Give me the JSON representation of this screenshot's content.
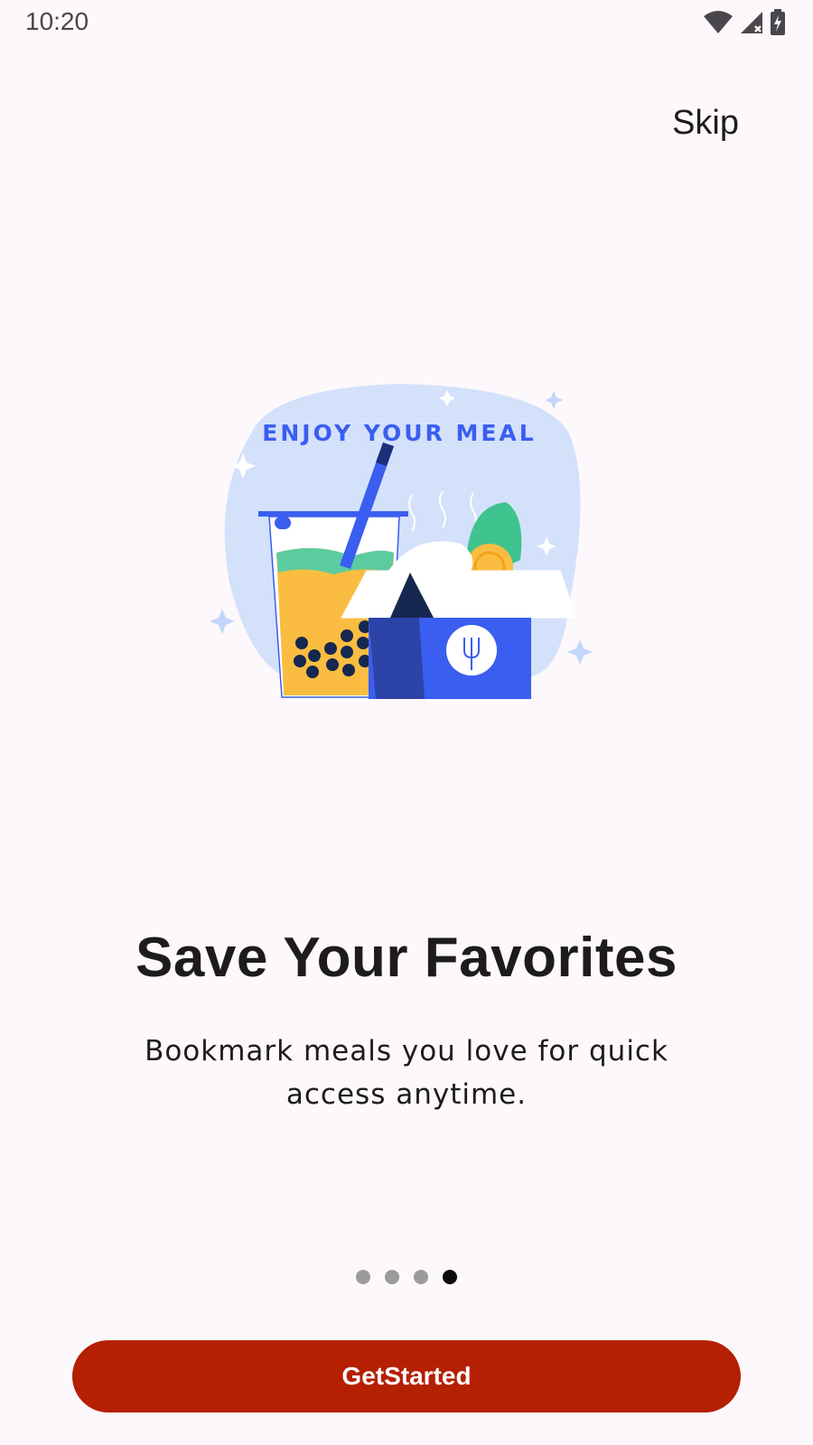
{
  "status_bar": {
    "time": "10:20",
    "icons": [
      "wifi-icon",
      "signal-icon",
      "battery-icon"
    ]
  },
  "header": {
    "skip_label": "Skip"
  },
  "illustration": {
    "banner_text": "ENJOY YOUR MEAL"
  },
  "content": {
    "title": "Save Your Favorites",
    "description": "Bookmark meals you love for quick access anytime."
  },
  "pager": {
    "total": 4,
    "active_index": 3
  },
  "cta": {
    "label": "GetStarted"
  },
  "colors": {
    "background": "#fdf8fb",
    "accent": "#b51f02",
    "illustration_blue": "#3a5ef0",
    "illustration_bg": "#d4e1fb"
  }
}
